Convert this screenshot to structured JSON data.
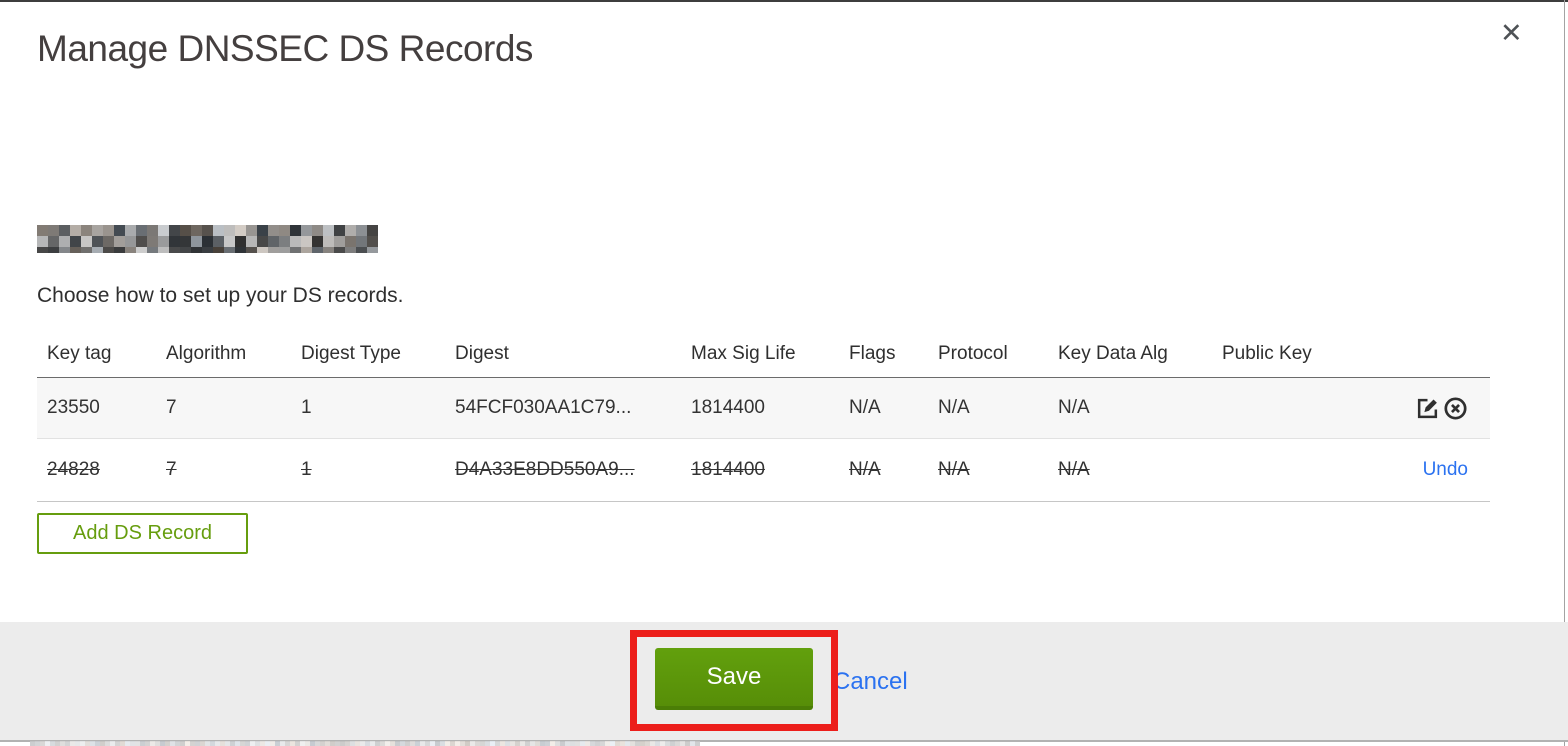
{
  "modal": {
    "title": "Manage DNSSEC DS Records",
    "close_glyph": "✕",
    "domain_redacted": true,
    "intro": "Choose how to set up your DS records.",
    "table": {
      "columns": [
        "Key tag",
        "Algorithm",
        "Digest Type",
        "Digest",
        "Max Sig Life",
        "Flags",
        "Protocol",
        "Key Data Alg",
        "Public Key"
      ],
      "rows": [
        {
          "key_tag": "23550",
          "algorithm": "7",
          "digest_type": "1",
          "digest": "54FCF030AA1C79...",
          "max_sig_life": "1814400",
          "flags": "N/A",
          "protocol": "N/A",
          "key_data_alg": "N/A",
          "public_key": "",
          "state": "active"
        },
        {
          "key_tag": "24828",
          "algorithm": "7",
          "digest_type": "1",
          "digest": "D4A33E8DD550A9...",
          "max_sig_life": "1814400",
          "flags": "N/A",
          "protocol": "N/A",
          "key_data_alg": "N/A",
          "public_key": "",
          "state": "marked-for-deletion",
          "undo_label": "Undo"
        }
      ]
    },
    "add_record_label": "Add DS Record",
    "footer": {
      "save_label": "Save",
      "cancel_label": "Cancel"
    },
    "icons": {
      "close": "close-icon",
      "edit": "edit-icon",
      "delete": "circle-x-icon"
    },
    "colors": {
      "accent_green": "#5d9a09",
      "link_blue": "#2b72f0",
      "annotation_red": "#ec1e1a",
      "footer_gray": "#ececec"
    }
  }
}
